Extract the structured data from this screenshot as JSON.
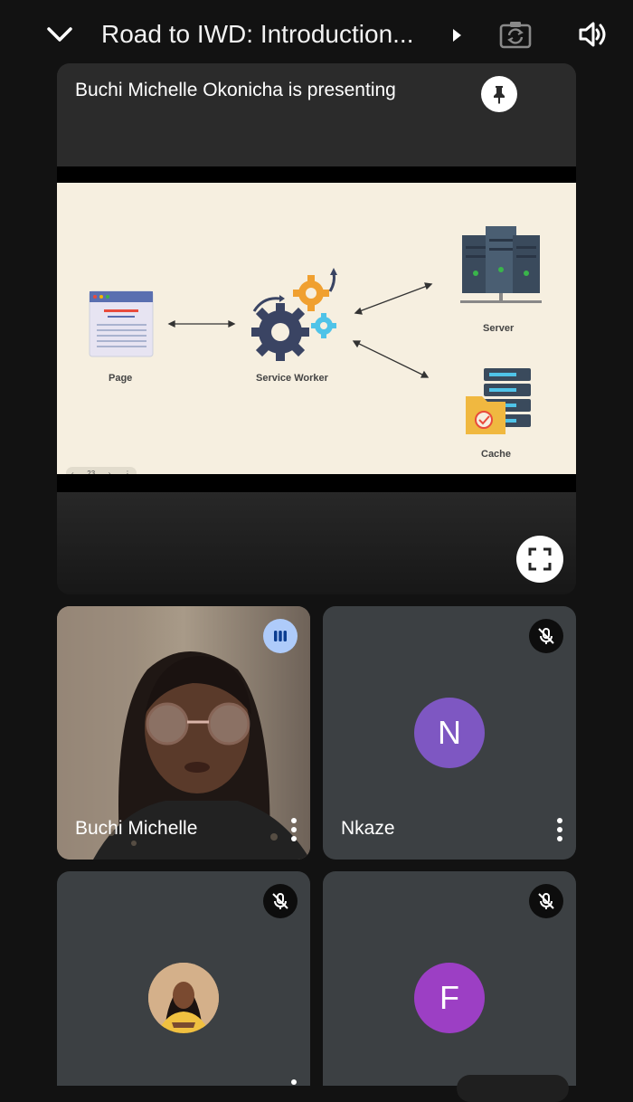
{
  "header": {
    "title": "Road to IWD: Introduction...",
    "icons": [
      "chevron-down-icon",
      "expand-arrow-icon",
      "camera-switch-icon",
      "speaker-icon"
    ]
  },
  "presentation": {
    "label": "Buchi Michelle Okonicha is presenting",
    "slide": {
      "labels": {
        "page": "Page",
        "service_worker": "Service Worker",
        "server": "Server",
        "cache": "Cache"
      },
      "page_number": "23"
    }
  },
  "participants": [
    {
      "name": "Buchi Michelle",
      "status": "speaking"
    },
    {
      "name": "Nkaze",
      "initial": "N",
      "status": "muted"
    },
    {
      "name": "",
      "status": "muted"
    },
    {
      "name": "",
      "initial": "F",
      "status": "muted"
    }
  ],
  "colors": {
    "background": "#121212",
    "tile": "#3c4043",
    "avatar_n": "#7e57c2",
    "avatar_f": "#9c3fc4",
    "speaking_badge": "#aecbfa"
  }
}
